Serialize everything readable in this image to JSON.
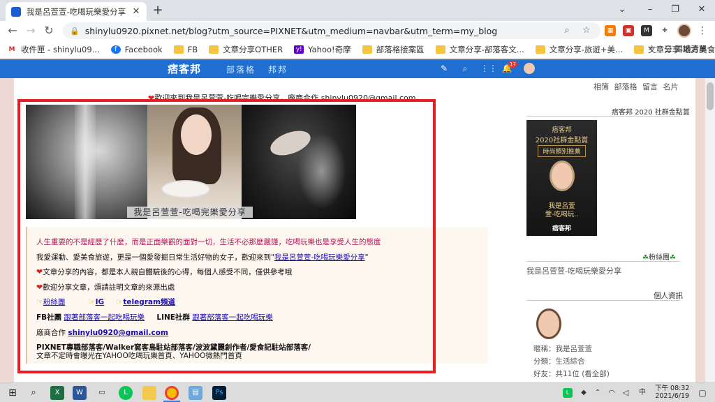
{
  "browser": {
    "tab_title": "我是呂萱萱-吃喝玩樂愛分享 :: 痞",
    "url": "shinylu0920.pixnet.net/blog?utm_source=PIXNET&utm_medium=navbar&utm_term=my_blog",
    "bookmarks": [
      {
        "label": "收件匣 - shinylu09...",
        "icon": "gmail-icon"
      },
      {
        "label": "Facebook",
        "icon": "facebook-icon"
      },
      {
        "label": "FB",
        "icon": "folder-icon"
      },
      {
        "label": "文章分享OTHER",
        "icon": "folder-icon"
      },
      {
        "label": "Yahoo!奇摩",
        "icon": "yahoo-icon"
      },
      {
        "label": "部落格接案區",
        "icon": "folder-icon"
      },
      {
        "label": "文章分享-部落客文...",
        "icon": "folder-icon"
      },
      {
        "label": "文章分享-旅遊+美...",
        "icon": "folder-icon"
      },
      {
        "label": "文章分享-地方美食...",
        "icon": "folder-icon"
      }
    ],
    "bookmarks_more": "»",
    "reading_list": "閱讀清單"
  },
  "pixnet_bar": {
    "logo": "痞客邦",
    "nav": [
      "部落格",
      "邦邦"
    ],
    "notification_count": "17"
  },
  "blog": {
    "welcome": "歡迎來到我是呂萱萱-吃喝完樂愛分享，廠商合作 shinylu0920@gmail.com",
    "top_links": "相簿 部落格 留言 名片",
    "banner_caption": "我是呂萱萱-吃喝完樂愛分享",
    "intro": {
      "line1": "人生重要的不是經歷了什麼，而是正面樂觀的面對一切，生活不必那麼嚴謹，吃喝玩樂也是享受人生的態度",
      "line2_prefix": "我愛運動、愛美食旅遊，更是一個愛發掘日常生活好物的女子，歡迎來到\"",
      "line2_link": "我是呂萱萱-吃喝玩樂愛分享",
      "line2_suffix": "\"",
      "line3": "文章分享的內容，都是本人親自體驗後的心得，每個人感受不同，僅供參考哦",
      "line4": "歡迎分享文章，煩請註明文章的來源出處",
      "social_links": [
        "粉絲團",
        "IG",
        "telegram頻道"
      ],
      "fb_label": "FB社團",
      "fb_link": "跟著部落客一起吃喝玩樂",
      "line_label": "LINE社群",
      "line_link": "跟著部落客一起吃喝玩樂",
      "contact_label": "廠商合作",
      "contact_email": "shinylu0920@gmail.com",
      "bio1": "PIXNET專職部落客/Walker窩客島駐站部落客/波波黛麗創作者/愛食記駐站部落客/",
      "bio2": "文章不定時會曝光在YAHOO吃喝玩樂首頁、YAHOO微熱門首頁"
    }
  },
  "sidebar": {
    "award_title": "痞客邦 2020 社群金點賞",
    "award_image": {
      "line1": "痞客邦",
      "line2": "2020社群金點賞",
      "line3": "時尚類別推薦",
      "line4": "我是呂萱\n萱-吃喝玩..",
      "line5": "痞客邦"
    },
    "fans_title": "粉絲團",
    "blog_name": "我是呂萱萱-吃喝玩樂愛分享",
    "profile_title": "個人資訊",
    "profile": [
      "暱稱：我是呂萱萱",
      "分類：生活綜合",
      "好友：共11位 (看全部)"
    ]
  },
  "taskbar": {
    "time": "下午 08:32",
    "date": "2021/6/19"
  }
}
